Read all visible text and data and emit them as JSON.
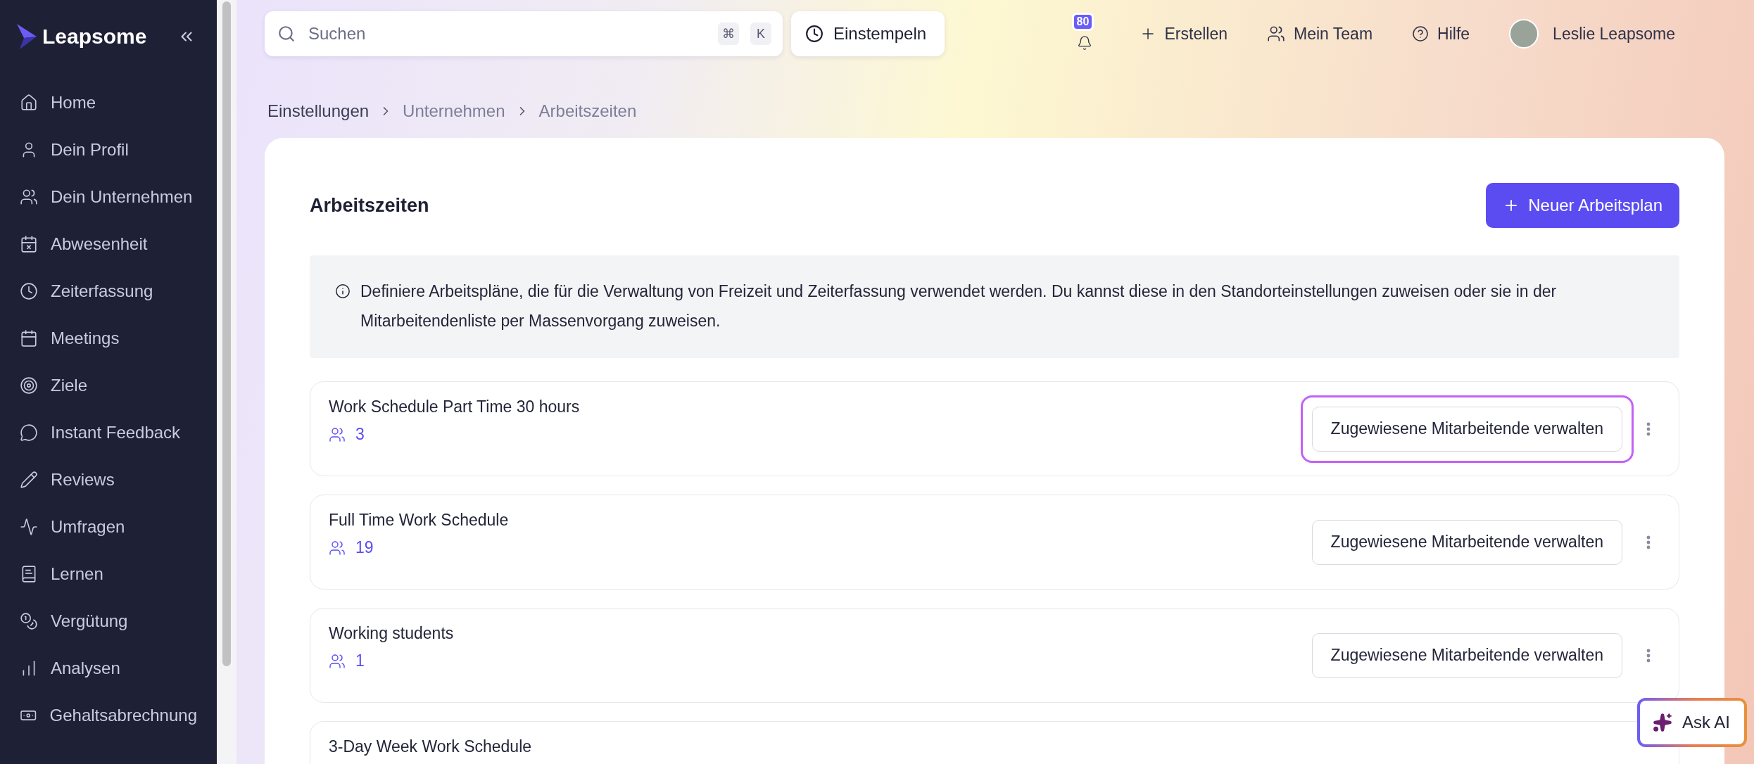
{
  "sidebar": {
    "logo": "Leapsome",
    "items": [
      {
        "label": "Home",
        "selected": false
      },
      {
        "label": "Dein Profil",
        "selected": false
      },
      {
        "label": "Dein Unternehmen",
        "selected": false
      },
      {
        "label": "Abwesenheit",
        "selected": false
      },
      {
        "label": "Zeiterfassung",
        "selected": false
      },
      {
        "label": "Meetings",
        "selected": false
      },
      {
        "label": "Ziele",
        "selected": false
      },
      {
        "label": "Instant Feedback",
        "selected": false
      },
      {
        "label": "Reviews",
        "selected": false
      },
      {
        "label": "Umfragen",
        "selected": false
      },
      {
        "label": "Lernen",
        "selected": false
      },
      {
        "label": "Vergütung",
        "selected": false
      },
      {
        "label": "Analysen",
        "selected": false
      },
      {
        "label": "Gehaltsabrechnung",
        "selected": false
      }
    ]
  },
  "topbar": {
    "search": {
      "placeholder": "Suchen",
      "keys": [
        "⌘",
        "K"
      ]
    },
    "clock_in": "Einstempeln",
    "notifications": "80",
    "create": "Erstellen",
    "team": "Mein Team",
    "help": "Hilfe",
    "user": "Leslie Leapsome"
  },
  "breadcrumb": [
    "Einstellungen",
    "Unternehmen",
    "Arbeitszeiten"
  ],
  "page": {
    "title": "Arbeitszeiten",
    "new_button": "Neuer Arbeitsplan",
    "info": "Definiere Arbeitspläne, die für die Verwaltung von Freizeit und Zeiterfassung verwendet werden. Du kannst diese in den Standorteinstellungen zuweisen oder sie in der Mitarbeitendenliste per Massenvorgang zuweisen.",
    "schedules": [
      {
        "name": "Work Schedule Part Time 30 hours",
        "count": "3",
        "action": "Zugewiesene Mitarbeitende verwalten",
        "focused": true
      },
      {
        "name": "Full Time Work Schedule",
        "count": "19",
        "action": "Zugewiesene Mitarbeitende verwalten",
        "focused": false
      },
      {
        "name": "Working students",
        "count": "1",
        "action": "Zugewiesene Mitarbeitende verwalten",
        "focused": false
      },
      {
        "name": "3-Day Week Work Schedule"
      }
    ]
  },
  "ask_ai": "Ask AI"
}
